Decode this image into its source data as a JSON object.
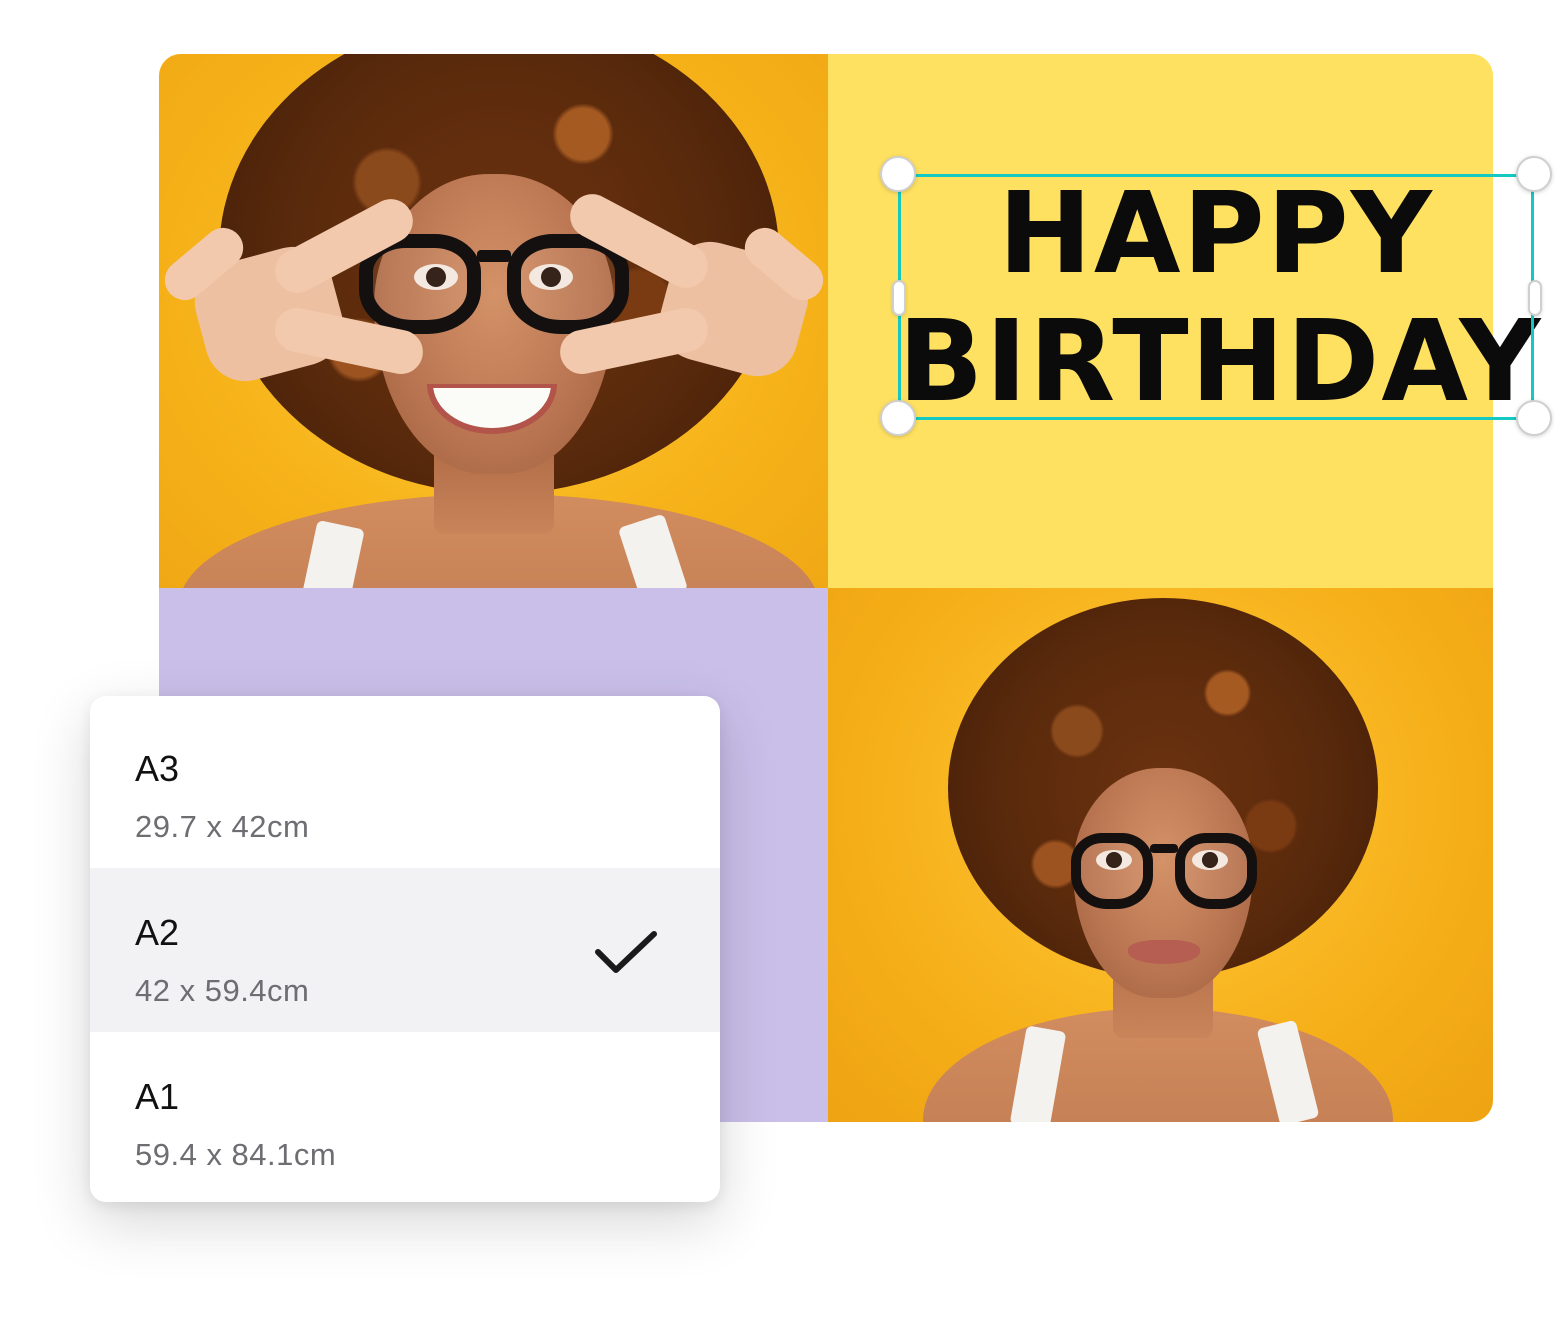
{
  "design": {
    "headline": {
      "line1": "HAPPY",
      "line2": "BIRTHDAY"
    },
    "colors": {
      "canvas_yellow": "#ffe161",
      "photo_orange": "#f7b31a",
      "panel_purple": "#c9bfe9",
      "selection_teal": "#13c9c2"
    }
  },
  "size_menu": {
    "items": [
      {
        "name": "A3",
        "dimensions": "29.7 x 42cm",
        "selected": false
      },
      {
        "name": "A2",
        "dimensions": "42 x 59.4cm",
        "selected": true
      },
      {
        "name": "A1",
        "dimensions": "59.4 x 84.1cm",
        "selected": false
      }
    ],
    "selected_icon": "checkmark-icon"
  }
}
